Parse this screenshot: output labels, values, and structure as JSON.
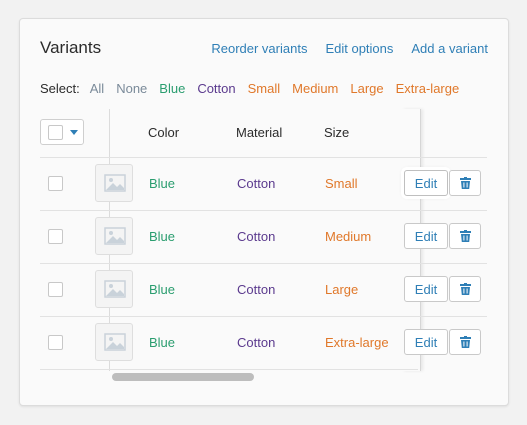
{
  "card": {
    "title": "Variants",
    "actions": [
      "Reorder variants",
      "Edit options",
      "Add a variant"
    ]
  },
  "select": {
    "label": "Select:",
    "options": [
      {
        "text": "All",
        "color": "#7a8a99"
      },
      {
        "text": "None",
        "color": "#7a8a99"
      },
      {
        "text": "Blue",
        "color": "#2a9d6f"
      },
      {
        "text": "Cotton",
        "color": "#5b3a8e"
      },
      {
        "text": "Small",
        "color": "#e0782a"
      },
      {
        "text": "Medium",
        "color": "#e0782a"
      },
      {
        "text": "Large",
        "color": "#e0782a"
      },
      {
        "text": "Extra-large",
        "color": "#e0782a"
      }
    ]
  },
  "table": {
    "headers": [
      "Color",
      "Material",
      "Size"
    ],
    "rows": [
      {
        "color": "Blue",
        "material": "Cotton",
        "size": "Small",
        "edit": "Edit"
      },
      {
        "color": "Blue",
        "material": "Cotton",
        "size": "Medium",
        "edit": "Edit"
      },
      {
        "color": "Blue",
        "material": "Cotton",
        "size": "Large",
        "edit": "Edit"
      },
      {
        "color": "Blue",
        "material": "Cotton",
        "size": "Extra-large",
        "edit": "Edit"
      }
    ]
  },
  "colors": {
    "link": "#2f7fb6",
    "color_value": "#2a9d6f",
    "material_value": "#5b3a8e",
    "size_value": "#e0782a"
  },
  "icons": {
    "image_placeholder": "image-icon",
    "delete": "trash-icon",
    "dropdown": "caret-down-icon"
  }
}
